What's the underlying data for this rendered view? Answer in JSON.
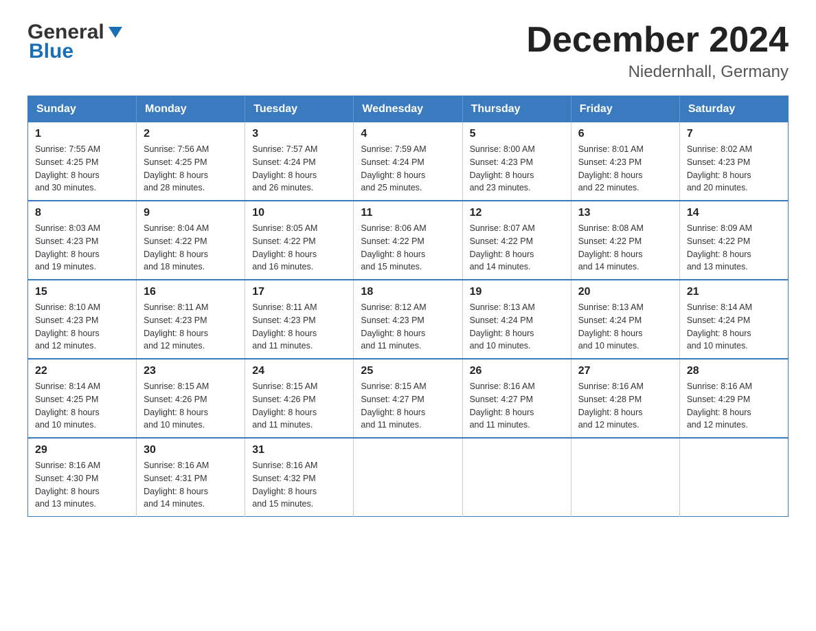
{
  "header": {
    "logo_general": "General",
    "logo_blue": "Blue",
    "month_title": "December 2024",
    "location": "Niedernhall, Germany"
  },
  "weekdays": [
    "Sunday",
    "Monday",
    "Tuesday",
    "Wednesday",
    "Thursday",
    "Friday",
    "Saturday"
  ],
  "weeks": [
    [
      {
        "day": "1",
        "sunrise": "7:55 AM",
        "sunset": "4:25 PM",
        "daylight": "8 hours and 30 minutes."
      },
      {
        "day": "2",
        "sunrise": "7:56 AM",
        "sunset": "4:25 PM",
        "daylight": "8 hours and 28 minutes."
      },
      {
        "day": "3",
        "sunrise": "7:57 AM",
        "sunset": "4:24 PM",
        "daylight": "8 hours and 26 minutes."
      },
      {
        "day": "4",
        "sunrise": "7:59 AM",
        "sunset": "4:24 PM",
        "daylight": "8 hours and 25 minutes."
      },
      {
        "day": "5",
        "sunrise": "8:00 AM",
        "sunset": "4:23 PM",
        "daylight": "8 hours and 23 minutes."
      },
      {
        "day": "6",
        "sunrise": "8:01 AM",
        "sunset": "4:23 PM",
        "daylight": "8 hours and 22 minutes."
      },
      {
        "day": "7",
        "sunrise": "8:02 AM",
        "sunset": "4:23 PM",
        "daylight": "8 hours and 20 minutes."
      }
    ],
    [
      {
        "day": "8",
        "sunrise": "8:03 AM",
        "sunset": "4:23 PM",
        "daylight": "8 hours and 19 minutes."
      },
      {
        "day": "9",
        "sunrise": "8:04 AM",
        "sunset": "4:22 PM",
        "daylight": "8 hours and 18 minutes."
      },
      {
        "day": "10",
        "sunrise": "8:05 AM",
        "sunset": "4:22 PM",
        "daylight": "8 hours and 16 minutes."
      },
      {
        "day": "11",
        "sunrise": "8:06 AM",
        "sunset": "4:22 PM",
        "daylight": "8 hours and 15 minutes."
      },
      {
        "day": "12",
        "sunrise": "8:07 AM",
        "sunset": "4:22 PM",
        "daylight": "8 hours and 14 minutes."
      },
      {
        "day": "13",
        "sunrise": "8:08 AM",
        "sunset": "4:22 PM",
        "daylight": "8 hours and 14 minutes."
      },
      {
        "day": "14",
        "sunrise": "8:09 AM",
        "sunset": "4:22 PM",
        "daylight": "8 hours and 13 minutes."
      }
    ],
    [
      {
        "day": "15",
        "sunrise": "8:10 AM",
        "sunset": "4:23 PM",
        "daylight": "8 hours and 12 minutes."
      },
      {
        "day": "16",
        "sunrise": "8:11 AM",
        "sunset": "4:23 PM",
        "daylight": "8 hours and 12 minutes."
      },
      {
        "day": "17",
        "sunrise": "8:11 AM",
        "sunset": "4:23 PM",
        "daylight": "8 hours and 11 minutes."
      },
      {
        "day": "18",
        "sunrise": "8:12 AM",
        "sunset": "4:23 PM",
        "daylight": "8 hours and 11 minutes."
      },
      {
        "day": "19",
        "sunrise": "8:13 AM",
        "sunset": "4:24 PM",
        "daylight": "8 hours and 10 minutes."
      },
      {
        "day": "20",
        "sunrise": "8:13 AM",
        "sunset": "4:24 PM",
        "daylight": "8 hours and 10 minutes."
      },
      {
        "day": "21",
        "sunrise": "8:14 AM",
        "sunset": "4:24 PM",
        "daylight": "8 hours and 10 minutes."
      }
    ],
    [
      {
        "day": "22",
        "sunrise": "8:14 AM",
        "sunset": "4:25 PM",
        "daylight": "8 hours and 10 minutes."
      },
      {
        "day": "23",
        "sunrise": "8:15 AM",
        "sunset": "4:26 PM",
        "daylight": "8 hours and 10 minutes."
      },
      {
        "day": "24",
        "sunrise": "8:15 AM",
        "sunset": "4:26 PM",
        "daylight": "8 hours and 11 minutes."
      },
      {
        "day": "25",
        "sunrise": "8:15 AM",
        "sunset": "4:27 PM",
        "daylight": "8 hours and 11 minutes."
      },
      {
        "day": "26",
        "sunrise": "8:16 AM",
        "sunset": "4:27 PM",
        "daylight": "8 hours and 11 minutes."
      },
      {
        "day": "27",
        "sunrise": "8:16 AM",
        "sunset": "4:28 PM",
        "daylight": "8 hours and 12 minutes."
      },
      {
        "day": "28",
        "sunrise": "8:16 AM",
        "sunset": "4:29 PM",
        "daylight": "8 hours and 12 minutes."
      }
    ],
    [
      {
        "day": "29",
        "sunrise": "8:16 AM",
        "sunset": "4:30 PM",
        "daylight": "8 hours and 13 minutes."
      },
      {
        "day": "30",
        "sunrise": "8:16 AM",
        "sunset": "4:31 PM",
        "daylight": "8 hours and 14 minutes."
      },
      {
        "day": "31",
        "sunrise": "8:16 AM",
        "sunset": "4:32 PM",
        "daylight": "8 hours and 15 minutes."
      },
      null,
      null,
      null,
      null
    ]
  ],
  "labels": {
    "sunrise": "Sunrise:",
    "sunset": "Sunset:",
    "daylight": "Daylight:"
  }
}
